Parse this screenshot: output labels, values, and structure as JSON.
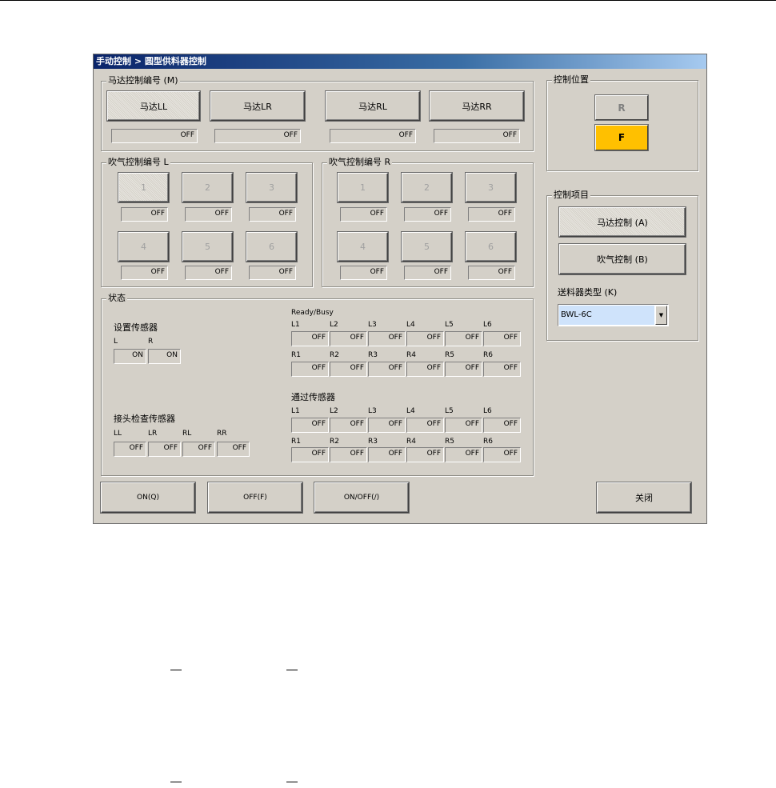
{
  "window": {
    "title": "手动控制 > 圆型供料器控制"
  },
  "motor_group": {
    "title": "马达控制编号 (M)",
    "buttons": [
      "马达LL",
      "马达LR",
      "马达RL",
      "马达RR"
    ],
    "states": [
      "OFF",
      "OFF",
      "OFF",
      "OFF"
    ]
  },
  "blow_left": {
    "title": "吹气控制编号 L",
    "buttons": [
      "1",
      "2",
      "3",
      "4",
      "5",
      "6"
    ],
    "states": [
      "OFF",
      "OFF",
      "OFF",
      "OFF",
      "OFF",
      "OFF"
    ]
  },
  "blow_right": {
    "title": "吹气控制编号 R",
    "buttons": [
      "1",
      "2",
      "3",
      "4",
      "5",
      "6"
    ],
    "states": [
      "OFF",
      "OFF",
      "OFF",
      "OFF",
      "OFF",
      "OFF"
    ]
  },
  "status": {
    "title": "状态",
    "set_sensor": {
      "label": "设置传感器",
      "cols": [
        "L",
        "R"
      ],
      "values": [
        "ON",
        "ON"
      ]
    },
    "joint_sensor": {
      "label": "接头检查传感器",
      "cols": [
        "LL",
        "LR",
        "RL",
        "RR"
      ],
      "values": [
        "OFF",
        "OFF",
        "OFF",
        "OFF"
      ]
    },
    "ready_busy": {
      "label": "Ready/Busy",
      "l_labels": [
        "L1",
        "L2",
        "L3",
        "L4",
        "L5",
        "L6"
      ],
      "l_values": [
        "OFF",
        "OFF",
        "OFF",
        "OFF",
        "OFF",
        "OFF"
      ],
      "r_labels": [
        "R1",
        "R2",
        "R3",
        "R4",
        "R5",
        "R6"
      ],
      "r_values": [
        "OFF",
        "OFF",
        "OFF",
        "OFF",
        "OFF",
        "OFF"
      ]
    },
    "pass_sensor": {
      "label": "通过传感器",
      "l_labels": [
        "L1",
        "L2",
        "L3",
        "L4",
        "L5",
        "L6"
      ],
      "l_values": [
        "OFF",
        "OFF",
        "OFF",
        "OFF",
        "OFF",
        "OFF"
      ],
      "r_labels": [
        "R1",
        "R2",
        "R3",
        "R4",
        "R5",
        "R6"
      ],
      "r_values": [
        "OFF",
        "OFF",
        "OFF",
        "OFF",
        "OFF",
        "OFF"
      ]
    }
  },
  "control_position": {
    "title": "控制位置",
    "r_label": "R",
    "f_label": "F",
    "active_color": "#ffc000"
  },
  "control_item": {
    "title": "控制项目",
    "motor_label": "马达控制 (A)",
    "blow_label": "吹气控制 (B)",
    "feeder_type_label": "送料器类型 (K)",
    "feeder_type_value": "BWL-6C"
  },
  "bottom": {
    "on_label": "ON(Q)",
    "off_label": "OFF(F)",
    "onoff_label": "ON/OFF(/)",
    "close_label": "关闭"
  }
}
